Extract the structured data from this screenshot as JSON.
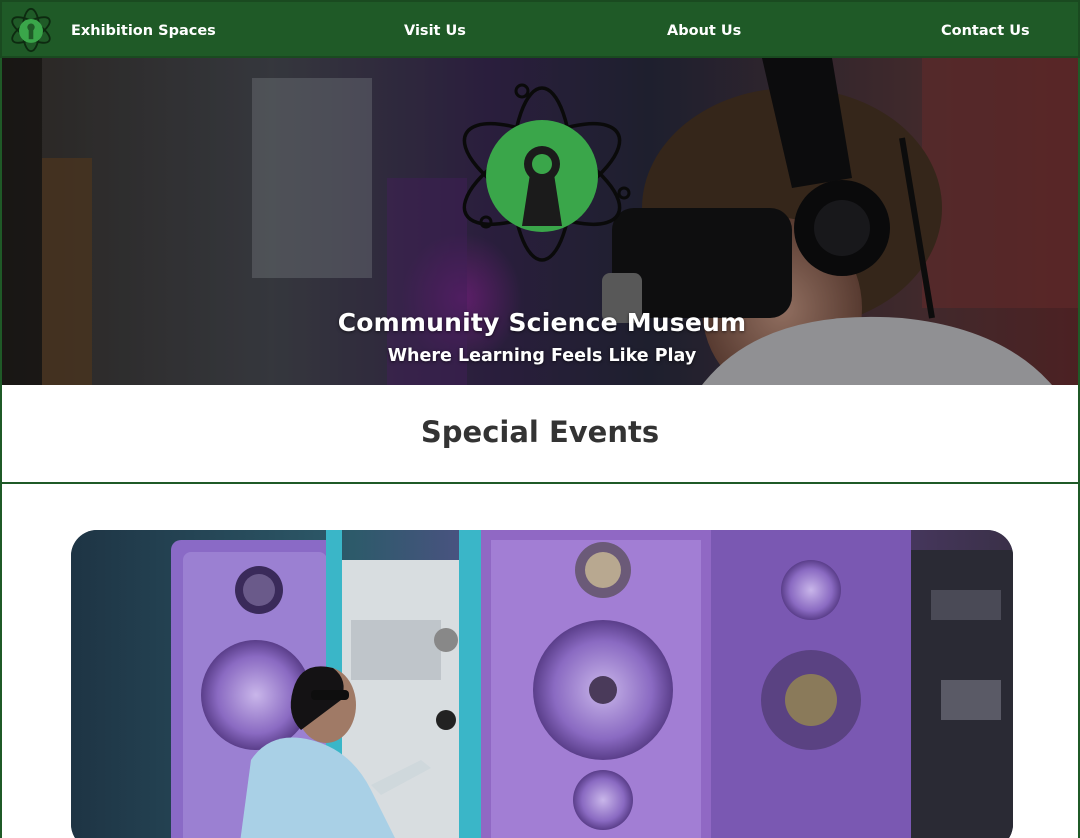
{
  "nav": {
    "logo_icon": "museum-atom-keyhole-logo",
    "links": [
      "Exhibition Spaces",
      "Visit Us",
      "About Us",
      "Contact Us"
    ]
  },
  "hero": {
    "title": "Community Science Museum",
    "subtitle": "Where Learning Feels Like Play",
    "logo_icon": "atom-keyhole-logo",
    "image": "person-wearing-vr-headset"
  },
  "events": {
    "heading": "Special Events",
    "card_image": "scientist-beside-vacuum-chamber"
  },
  "colors": {
    "nav_bg": "#1f5a27",
    "logo_green": "#3aa64a",
    "heading_text": "#333333",
    "border": "#1f5a27"
  }
}
